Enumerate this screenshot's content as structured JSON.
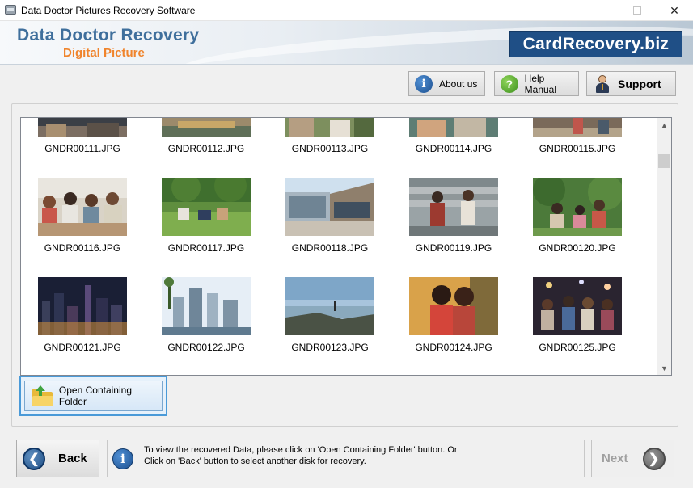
{
  "window": {
    "title": "Data Doctor Pictures Recovery Software",
    "minimize": "—",
    "maximize": "□",
    "close": "✕"
  },
  "banner": {
    "brand_line1": "Data Doctor Recovery",
    "brand_line2": "Digital Picture",
    "site": "CardRecovery.biz"
  },
  "toolbar": {
    "about": "About us",
    "help": "Help Manual",
    "support": "Support"
  },
  "files": {
    "row_top": [
      "GNDR00111.JPG",
      "GNDR00112.JPG",
      "GNDR00113.JPG",
      "GNDR00114.JPG",
      "GNDR00115.JPG"
    ],
    "row_mid": [
      "GNDR00116.JPG",
      "GNDR00117.JPG",
      "GNDR00118.JPG",
      "GNDR00119.JPG",
      "GNDR00120.JPG"
    ],
    "row_low": [
      "GNDR00121.JPG",
      "GNDR00122.JPG",
      "GNDR00123.JPG",
      "GNDR00124.JPG",
      "GNDR00125.JPG"
    ]
  },
  "folder_button": "Open Containing Folder",
  "back": "Back",
  "next": "Next",
  "info": {
    "line1": "To view the recovered Data, please click on 'Open Containing Folder' button. Or",
    "line2": "Click on 'Back' button to select another disk for recovery."
  },
  "colors": {
    "brand_blue": "#3f6f9c",
    "brand_orange": "#f0842c",
    "site_bg": "#1f4f86",
    "selection": "#4a9ad8"
  },
  "icons": {
    "about": "info-icon",
    "help": "question-icon",
    "support": "support-person-icon",
    "folder": "folder-open-icon",
    "back": "arrow-left-icon",
    "next": "arrow-right-icon"
  }
}
